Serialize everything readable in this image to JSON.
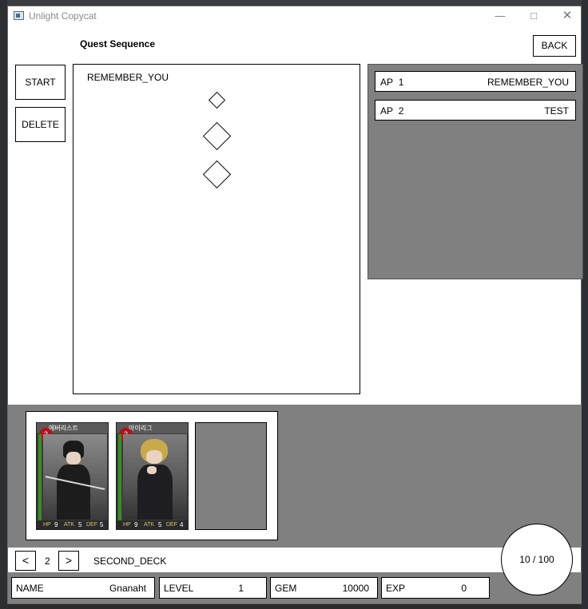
{
  "window": {
    "title": "Unlight Copycat",
    "controls": [
      "minimize",
      "maximize",
      "close"
    ]
  },
  "header": {
    "title": "Quest Sequence",
    "back_label": "BACK"
  },
  "left_buttons": {
    "start_label": "START",
    "delete_label": "DELETE"
  },
  "sequence_panel": {
    "selected_quest": "REMEMBER_YOU",
    "nodes": 3
  },
  "quest_list": {
    "items": [
      {
        "ap_label": "AP",
        "ap_value": "1",
        "name": "REMEMBER_YOU"
      },
      {
        "ap_label": "AP",
        "ap_value": "2",
        "name": "TEST"
      }
    ]
  },
  "deck": {
    "cards": [
      {
        "level": "2",
        "name": "에버리스트",
        "hp": "9",
        "atk": "5",
        "def": "5",
        "stat_labels": [
          "HP",
          "ATK",
          "DEF"
        ]
      },
      {
        "level": "2",
        "name": "아이리그",
        "hp": "9",
        "atk": "5",
        "def": "4",
        "stat_labels": [
          "HP",
          "ATK",
          "DEF"
        ]
      }
    ],
    "empty_slots": 1,
    "nav": {
      "prev": "<",
      "page": "2",
      "next": ">",
      "name": "SECOND_DECK"
    }
  },
  "energy": {
    "current": "10",
    "separator": "/",
    "max": "100"
  },
  "status": {
    "name_label": "NAME",
    "name_value": "Gnanaht",
    "level_label": "LEVEL",
    "level_value": "1",
    "gem_label": "GEM",
    "gem_value": "10000",
    "exp_label": "EXP",
    "exp_value": "0"
  },
  "colors": {
    "panel_gray": "#808080",
    "card_red": "#b3121b",
    "card_green": "#3c8c2a"
  }
}
